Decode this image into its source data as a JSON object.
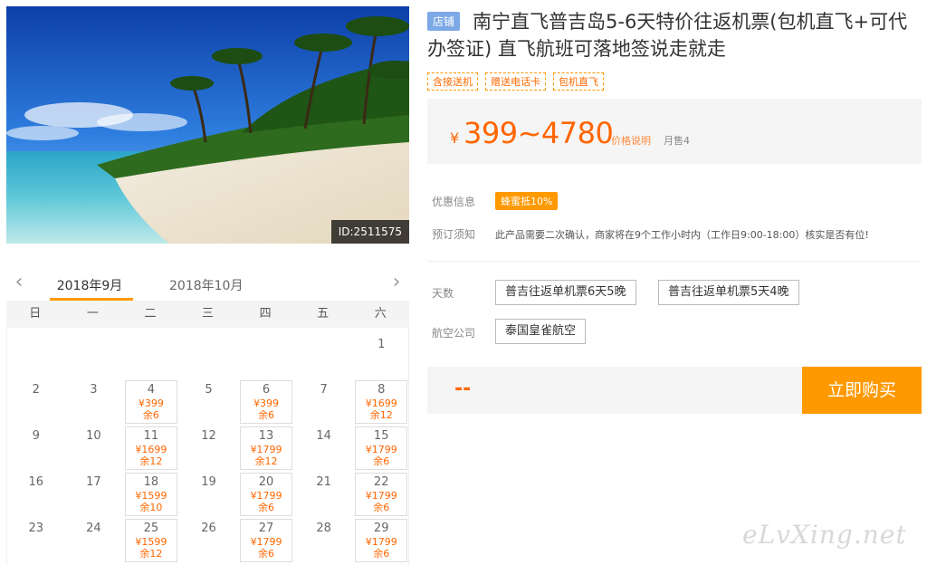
{
  "hero": {
    "image_id": "ID:2511575"
  },
  "calendar": {
    "prev_arrow": "‹",
    "next_arrow": "›",
    "months": [
      "2018年9月",
      "2018年10月"
    ],
    "weekdays": [
      "日",
      "一",
      "二",
      "三",
      "四",
      "五",
      "六"
    ],
    "days": [
      {
        "day": "1",
        "col": 6,
        "row": 0
      },
      {
        "day": "2",
        "col": 0,
        "row": 1
      },
      {
        "day": "3",
        "col": 1,
        "row": 1
      },
      {
        "day": "4",
        "col": 2,
        "row": 1,
        "price": "¥399",
        "remain": "余6"
      },
      {
        "day": "5",
        "col": 3,
        "row": 1
      },
      {
        "day": "6",
        "col": 4,
        "row": 1,
        "price": "¥399",
        "remain": "余6"
      },
      {
        "day": "7",
        "col": 5,
        "row": 1
      },
      {
        "day": "8",
        "col": 6,
        "row": 1,
        "price": "¥1699",
        "remain": "余12"
      },
      {
        "day": "9",
        "col": 0,
        "row": 2
      },
      {
        "day": "10",
        "col": 1,
        "row": 2
      },
      {
        "day": "11",
        "col": 2,
        "row": 2,
        "price": "¥1699",
        "remain": "余12"
      },
      {
        "day": "12",
        "col": 3,
        "row": 2
      },
      {
        "day": "13",
        "col": 4,
        "row": 2,
        "price": "¥1799",
        "remain": "余12"
      },
      {
        "day": "14",
        "col": 5,
        "row": 2
      },
      {
        "day": "15",
        "col": 6,
        "row": 2,
        "price": "¥1799",
        "remain": "余6"
      },
      {
        "day": "16",
        "col": 0,
        "row": 3
      },
      {
        "day": "17",
        "col": 1,
        "row": 3
      },
      {
        "day": "18",
        "col": 2,
        "row": 3,
        "price": "¥1599",
        "remain": "余10"
      },
      {
        "day": "19",
        "col": 3,
        "row": 3
      },
      {
        "day": "20",
        "col": 4,
        "row": 3,
        "price": "¥1799",
        "remain": "余6"
      },
      {
        "day": "21",
        "col": 5,
        "row": 3
      },
      {
        "day": "22",
        "col": 6,
        "row": 3,
        "price": "¥1799",
        "remain": "余6"
      },
      {
        "day": "23",
        "col": 0,
        "row": 4
      },
      {
        "day": "24",
        "col": 1,
        "row": 4
      },
      {
        "day": "25",
        "col": 2,
        "row": 4,
        "price": "¥1599",
        "remain": "余12"
      },
      {
        "day": "26",
        "col": 3,
        "row": 4
      },
      {
        "day": "27",
        "col": 4,
        "row": 4,
        "price": "¥1799",
        "remain": "余6"
      },
      {
        "day": "28",
        "col": 5,
        "row": 4
      },
      {
        "day": "29",
        "col": 6,
        "row": 4,
        "price": "¥1799",
        "remain": "余6"
      }
    ]
  },
  "product": {
    "store_badge": "店铺",
    "title": "南宁直飞普吉岛5-6天特价往返机票(包机直飞+可代办签证) 直飞航班可落地签说走就走",
    "tags": [
      "含接送机",
      "赠送电话卡",
      "包机直飞"
    ],
    "price_currency": "¥",
    "price_range": "399~4780",
    "price_note": "价格说明",
    "monthly_sales": "月售4",
    "promo_label": "优惠信息",
    "promo_badge": "蜂蜜抵10%",
    "notice_label": "预订须知",
    "notice_text": "此产品需要二次确认，商家将在9个工作小时内（工作日9:00-18:00）核实是否有位!",
    "days_label": "天数",
    "day_options": [
      "普吉往返单机票6天5晚",
      "普吉往返单机票5天4晚"
    ],
    "airline_label": "航空公司",
    "airline_options": [
      "泰国皇雀航空"
    ],
    "selected_price": "--",
    "buy_button": "立即购买"
  },
  "watermark": "eLvXing.net",
  "colors": {
    "accent": "#ff9900",
    "price": "#ff6600",
    "badge_blue": "#7da8e6"
  }
}
